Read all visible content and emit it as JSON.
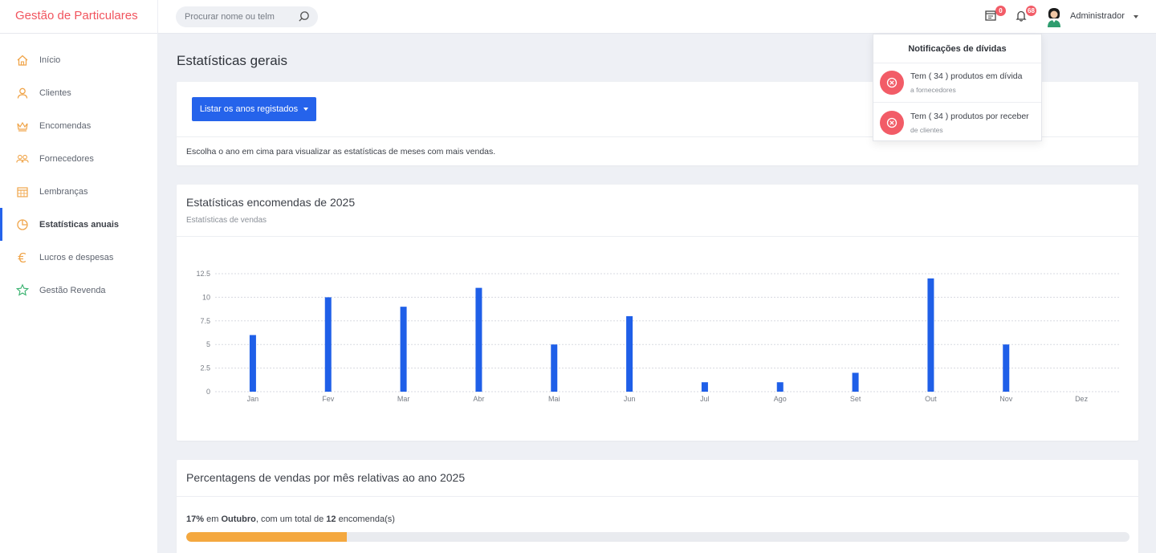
{
  "app": {
    "brand": "Gestão de Particulares"
  },
  "header": {
    "search_placeholder": "Procurar nome ou telm",
    "calendar_badge": "0",
    "bell_badge": "68",
    "user_name": "Administrador"
  },
  "sidebar": {
    "items": [
      {
        "label": "Início",
        "icon": "home-icon"
      },
      {
        "label": "Clientes",
        "icon": "user-icon"
      },
      {
        "label": "Encomendas",
        "icon": "crown-icon"
      },
      {
        "label": "Fornecedores",
        "icon": "users-icon"
      },
      {
        "label": "Lembranças",
        "icon": "calendar-icon"
      },
      {
        "label": "Estatísticas anuais",
        "icon": "pie-chart-icon"
      },
      {
        "label": "Lucros e despesas",
        "icon": "euro-icon"
      },
      {
        "label": "Gestão Revenda",
        "icon": "star-icon"
      }
    ],
    "active_index": 5
  },
  "main": {
    "page_title": "Estatísticas gerais",
    "years_button": "Listar os anos registados",
    "hint": "Escolha o ano em cima para visualizar as estatísticas de meses com mais vendas.",
    "chart_card": {
      "title": "Estatísticas encomendas de 2025",
      "subtitle": "Estatísticas de vendas"
    },
    "pct_card": {
      "title": "Percentagens de vendas por mês relativas ao ano 2025",
      "line": {
        "pct": "17%",
        "in": "em",
        "month": "Outubro",
        "mid": ", com um total de",
        "count": "12",
        "suffix": "encomenda(s)"
      },
      "progress_pct": 17
    }
  },
  "notifications": {
    "title": "Notificações de dívidas",
    "items": [
      {
        "text": "Tem ( 34 ) produtos em dívida",
        "sub": "a fornecedores"
      },
      {
        "text": "Tem ( 34 ) produtos por receber",
        "sub": "de clientes"
      }
    ]
  },
  "colors": {
    "brand": "#f1545e",
    "accent": "#2563eb",
    "bar": "#1f5fe8",
    "progress": "#f4a83f",
    "badge": "#f25c67"
  },
  "chart_data": {
    "type": "bar",
    "categories": [
      "Jan",
      "Fev",
      "Mar",
      "Abr",
      "Mai",
      "Jun",
      "Jul",
      "Ago",
      "Set",
      "Out",
      "Nov",
      "Dez"
    ],
    "values": [
      6,
      10,
      9,
      11,
      5,
      8,
      1,
      1,
      2,
      12,
      5,
      0
    ],
    "yticks": [
      "0",
      "2.5",
      "5",
      "7.5",
      "10",
      "12.5"
    ],
    "ylim": [
      0,
      12.5
    ],
    "grid": true,
    "title": "Estatísticas encomendas de 2025",
    "subtitle": "Estatísticas de vendas"
  }
}
